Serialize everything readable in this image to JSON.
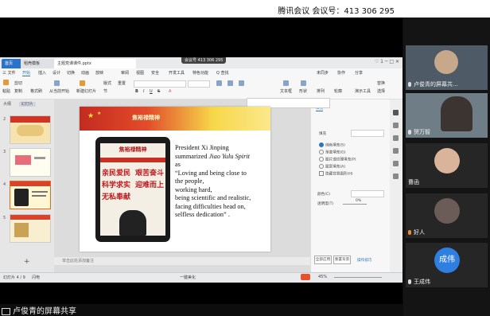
{
  "meeting": {
    "title": "腾讯会议 会议号：413 306 295",
    "id_overlay": "会议号 413 306 295",
    "share_label": "卢俊青的屏幕共享"
  },
  "wps": {
    "tabs": [
      "首页",
      "稻壳模板",
      "主题党课课件.pptx"
    ],
    "window_controls": "♡ 1 ─ □ ✕",
    "menu": [
      "三 文件",
      "开始",
      "插入",
      "设计",
      "切换",
      "动画",
      "放映",
      "审阅",
      "视图",
      "安全",
      "开发工具",
      "特色功能",
      "Q 查找"
    ],
    "menu_active_index": 1,
    "toolbar_right": [
      "未同步",
      "协作",
      "分享"
    ],
    "toolbar": {
      "paste": "粘贴",
      "cut": "剪切",
      "copy": "复制",
      "format_painter": "格式刷",
      "from_current": "从当前开始",
      "new_slide": "新建幻灯片",
      "layout": "版式",
      "section": "节",
      "reset": "重置",
      "text_box": "文本框",
      "shape": "形状",
      "arrange": "排列",
      "outline": "轮廓",
      "demo_tools": "演示工具",
      "replace": "替换",
      "select": "选择"
    },
    "left_panel": {
      "tabs": [
        "大纲",
        "幻灯片"
      ],
      "slide_numbers": [
        "2",
        "3",
        "4",
        "5"
      ],
      "selected_index": 2,
      "add_button": "+"
    },
    "slide": {
      "header_title": "焦裕禄精神",
      "tablet_title": "焦裕禄精神",
      "mottos": [
        [
          "亲民爱民",
          "艰苦奋斗"
        ],
        [
          "科学求实",
          "迎难而上"
        ],
        [
          "无私奉献",
          ""
        ]
      ],
      "text_lines": [
        {
          "t": "President Xi Jinping",
          "i": false
        },
        {
          "t": "summarized ",
          "i": false,
          "i2": "Jiao Yulu Spirit"
        },
        {
          "t": "as",
          "i": false
        },
        {
          "t": "“Loving and being close to",
          "i": false
        },
        {
          "t": "the people,",
          "i": false
        },
        {
          "t": "working hard,",
          "i": false
        },
        {
          "t": "being scientific and realistic,",
          "i": false
        },
        {
          "t": "facing difficulties head on,",
          "i": false
        },
        {
          "t": "selfless dedication” .",
          "i": false
        }
      ]
    },
    "right_panel": {
      "tab": "填充",
      "section": "填充",
      "options": [
        "纯色填充(S)",
        "渐变填充(G)",
        "图片或纹理填充(P)",
        "图案填充(A)",
        "隐藏背景图形(H)"
      ],
      "selected_option": 0,
      "color_label": "颜色(C)",
      "transparency_label": "透明度(T)",
      "transparency_value": "0%",
      "btn_apply_all": "全部应用",
      "btn_reset": "重置背景",
      "more": "操作技巧"
    },
    "notes_placeholder": "单击此处添加备注",
    "status": {
      "slide_info": "幻灯片 4 / 9",
      "theme": "闪电",
      "beautify": "一键美化",
      "zoom": "45%"
    }
  },
  "participants": [
    {
      "name": "卢俊青的屏幕共..."
    },
    {
      "name": "贺万智"
    },
    {
      "name": "曹函"
    },
    {
      "name": "好人"
    },
    {
      "name": "王成伟",
      "avatar_text": "成伟"
    }
  ],
  "colors": {
    "wps_blue": "#2c72c7",
    "slide_red": "#c0191d",
    "avatar_blue": "#2f7fe2"
  }
}
